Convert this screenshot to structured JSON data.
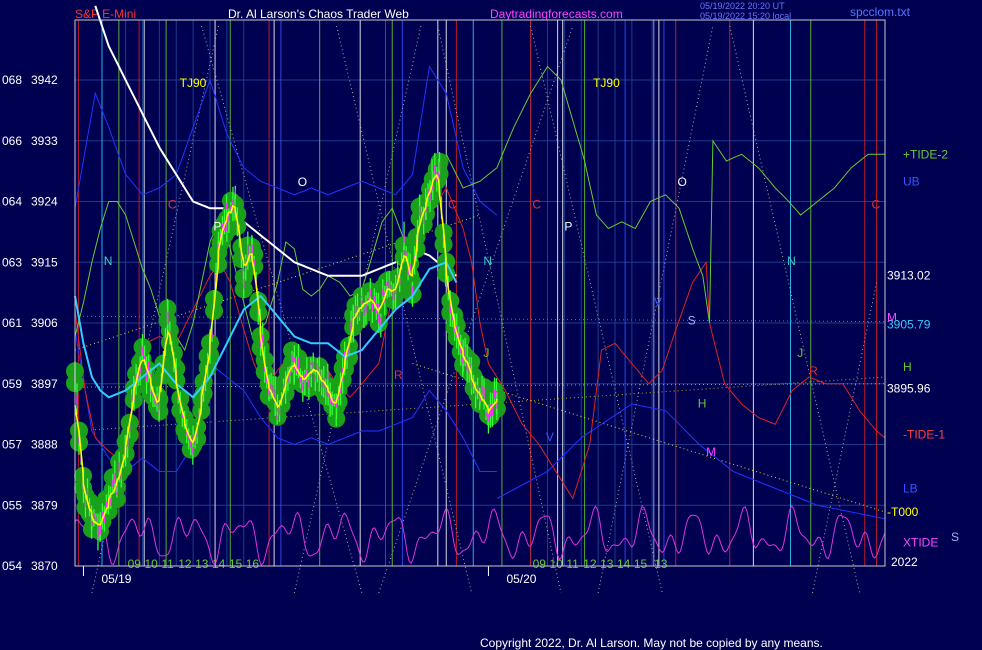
{
  "header": {
    "instrument": "S&P E-Mini",
    "site_title": "Dr. Al Larson's Chaos Trader Web",
    "site_url": "Daytradingforecasts.com",
    "stamp_line1": "05/19/2022 20:20 UT",
    "stamp_line2": "05/19/2022 15:20 local",
    "file_name": "spcclom.txt"
  },
  "footer": {
    "copyright": "Copyright 2022, Dr. Al Larson. May not be copied by any means."
  },
  "colors": {
    "background": "#000050",
    "frame": "#c8c8c8",
    "grid": "#1c3c8c",
    "price_yellow": "#ffff00",
    "price_magenta": "#ff33ff",
    "green_dots": "#1aa01a",
    "bright_green": "#33ff33",
    "avg_white": "#ffffff",
    "avg_cyan": "#33ccff",
    "tide_red": "#dd2222",
    "tide_green": "#66cc33",
    "band_blue": "#2233ff",
    "xtide_magenta": "#dd33dd",
    "title_red": "#ff3030",
    "title_white": "#ffffff",
    "title_magenta": "#ff44ff"
  },
  "chart_data": {
    "type": "line",
    "y_ticks": [
      {
        "cycle": "068",
        "price": "3942",
        "value": 3942
      },
      {
        "cycle": "066",
        "price": "3933",
        "value": 3933
      },
      {
        "cycle": "064",
        "price": "3924",
        "value": 3924
      },
      {
        "cycle": "063",
        "price": "3915",
        "value": 3915
      },
      {
        "cycle": "061",
        "price": "3906",
        "value": 3906
      },
      {
        "cycle": "059",
        "price": "3897",
        "value": 3897
      },
      {
        "cycle": "057",
        "price": "3888",
        "value": 3888
      },
      {
        "cycle": "055",
        "price": "3879",
        "value": 3879
      },
      {
        "cycle": "054",
        "price": "3870",
        "value": 3870
      }
    ],
    "ylim": [
      3870,
      3942
    ],
    "x_range_hours": [
      0,
      48
    ],
    "x_ticks": [
      {
        "label": "09",
        "hour": 3
      },
      {
        "label": "10",
        "hour": 4
      },
      {
        "label": "11",
        "hour": 5
      },
      {
        "label": "12",
        "hour": 6
      },
      {
        "label": "13",
        "hour": 7
      },
      {
        "label": "14",
        "hour": 8
      },
      {
        "label": "15",
        "hour": 9
      },
      {
        "label": "16",
        "hour": 10
      },
      {
        "label": "09",
        "hour": 27
      },
      {
        "label": "10",
        "hour": 28
      },
      {
        "label": "11",
        "hour": 29
      },
      {
        "label": "12",
        "hour": 30
      },
      {
        "label": "13",
        "hour": 31
      },
      {
        "label": "14",
        "hour": 32
      },
      {
        "label": "15",
        "hour": 33
      },
      {
        "label": "13",
        "hour": 34.2
      }
    ],
    "year_label": "2022",
    "dates": [
      {
        "label": "05/19",
        "hour": 0.5
      },
      {
        "label": "05/20",
        "hour": 24.5
      }
    ],
    "right_labels": [
      {
        "text": "+TIDE-2",
        "value": 3931,
        "color": "#66cc33"
      },
      {
        "text": "UB",
        "value": 3927,
        "color": "#3355ff"
      },
      {
        "text": "3913.02",
        "value": 3913.02,
        "color": "#ffffff"
      },
      {
        "text": "3905.79",
        "value": 3905.79,
        "color": "#33ccff"
      },
      {
        "text": "M",
        "value": 3906.8,
        "color": "#ff44ff"
      },
      {
        "text": "H",
        "value": 3899.5,
        "color": "#66cc33"
      },
      {
        "text": "3895.96",
        "value": 3896.3,
        "color": "#ffffff"
      },
      {
        "text": "-TIDE-1",
        "value": 3889.5,
        "color": "#ff4040"
      },
      {
        "text": "LB",
        "value": 3881.5,
        "color": "#3355ff"
      },
      {
        "text": "-T000",
        "value": 3878,
        "color": "#ffff00"
      },
      {
        "text": "XTIDE",
        "value": 3873.5,
        "color": "#ff44ff"
      },
      {
        "text": "S",
        "value": 3874.3,
        "color": "#aaaaff"
      }
    ],
    "letter_marks": [
      {
        "text": "TJ90",
        "hour": 6.2,
        "value": 3941,
        "color": "#ffff00"
      },
      {
        "text": "TJ90",
        "hour": 30.7,
        "value": 3941,
        "color": "#ffff00"
      },
      {
        "text": "N",
        "hour": 1.7,
        "value": 3914.6,
        "color": "#44cccc"
      },
      {
        "text": "N",
        "hour": 24.2,
        "value": 3914.6,
        "color": "#44cccc"
      },
      {
        "text": "N",
        "hour": 42.2,
        "value": 3914.6,
        "color": "#44cccc"
      },
      {
        "text": "C",
        "hour": 5.5,
        "value": 3923,
        "color": "#dd3333"
      },
      {
        "text": "C",
        "hour": 22.1,
        "value": 3923,
        "color": "#dd3333"
      },
      {
        "text": "C",
        "hour": 27.1,
        "value": 3923,
        "color": "#dd3333"
      },
      {
        "text": "C",
        "hour": 47.2,
        "value": 3923,
        "color": "#dd3333"
      },
      {
        "text": "P",
        "hour": 8.2,
        "value": 3919.7,
        "color": "#ffffff"
      },
      {
        "text": "P",
        "hour": 29.0,
        "value": 3919.7,
        "color": "#ffffff"
      },
      {
        "text": "O",
        "hour": 13.2,
        "value": 3926.3,
        "color": "#ffffff"
      },
      {
        "text": "O",
        "hour": 35.7,
        "value": 3926.3,
        "color": "#ffffff"
      },
      {
        "text": "J",
        "hour": 24.2,
        "value": 3901,
        "color": "#66cc33"
      },
      {
        "text": "J",
        "hour": 42.8,
        "value": 3901,
        "color": "#66cc33"
      },
      {
        "text": "R",
        "hour": 18.9,
        "value": 3897.7,
        "color": "#dd3333"
      },
      {
        "text": "R",
        "hour": 43.5,
        "value": 3898.3,
        "color": "#dd3333"
      },
      {
        "text": "S",
        "hour": 36.3,
        "value": 3905.8,
        "color": "#aaaaff"
      },
      {
        "text": "H",
        "hour": 36.9,
        "value": 3893.5,
        "color": "#66cc33"
      },
      {
        "text": "V",
        "hour": 34.3,
        "value": 3908.5,
        "color": "#3355ff"
      },
      {
        "text": "V",
        "hour": 27.9,
        "value": 3888.5,
        "color": "#3355ff"
      },
      {
        "text": "M",
        "hour": 37.4,
        "value": 3886.3,
        "color": "#ff44ff"
      }
    ]
  }
}
